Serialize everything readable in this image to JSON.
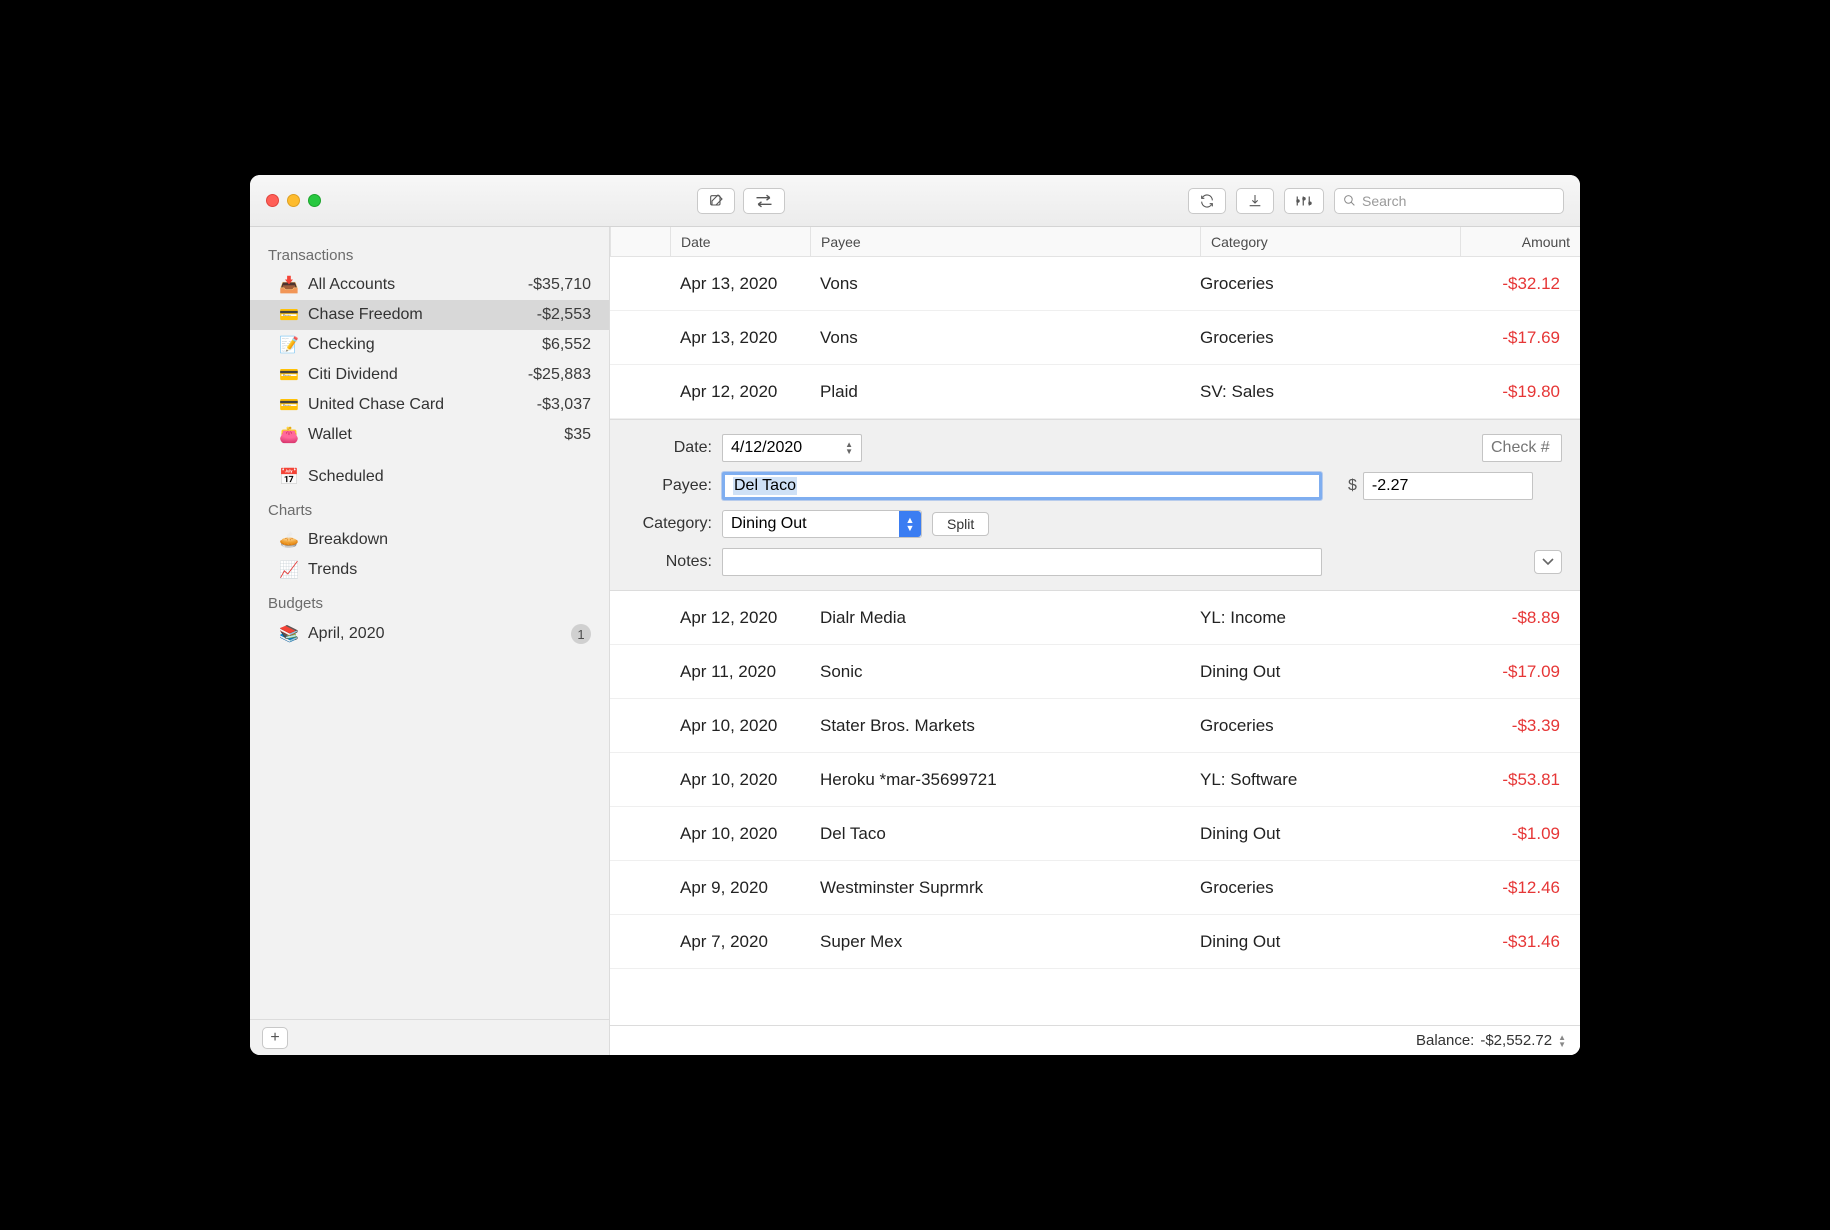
{
  "search": {
    "placeholder": "Search"
  },
  "sidebar": {
    "sections": [
      {
        "header": "Transactions",
        "items": [
          {
            "icon": "📥",
            "label": "All Accounts",
            "amount": "-$35,710",
            "selected": false
          },
          {
            "icon": "💳",
            "label": "Chase Freedom",
            "amount": "-$2,553",
            "selected": true
          },
          {
            "icon": "📝",
            "label": "Checking",
            "amount": "$6,552",
            "selected": false
          },
          {
            "icon": "💳",
            "label": "Citi Dividend",
            "amount": "-$25,883",
            "selected": false
          },
          {
            "icon": "💳",
            "label": "United Chase Card",
            "amount": "-$3,037",
            "selected": false
          },
          {
            "icon": "👛",
            "label": "Wallet",
            "amount": "$35",
            "selected": false
          },
          {
            "icon": "📅",
            "label": "Scheduled",
            "amount": "",
            "selected": false
          }
        ]
      },
      {
        "header": "Charts",
        "items": [
          {
            "icon": "🥧",
            "label": "Breakdown",
            "amount": "",
            "selected": false
          },
          {
            "icon": "📈",
            "label": "Trends",
            "amount": "",
            "selected": false
          }
        ]
      },
      {
        "header": "Budgets",
        "items": [
          {
            "icon": "📚",
            "label": "April, 2020",
            "amount": "",
            "badge": "1",
            "selected": false
          }
        ]
      }
    ]
  },
  "table": {
    "headers": {
      "date": "Date",
      "payee": "Payee",
      "category": "Category",
      "amount": "Amount"
    },
    "rows_before": [
      {
        "date": "Apr 13, 2020",
        "payee": "Vons",
        "category": "Groceries",
        "amount": "-$32.12"
      },
      {
        "date": "Apr 13, 2020",
        "payee": "Vons",
        "category": "Groceries",
        "amount": "-$17.69"
      },
      {
        "date": "Apr 12, 2020",
        "payee": "Plaid",
        "category": "SV: Sales",
        "amount": "-$19.80"
      }
    ],
    "rows_after": [
      {
        "date": "Apr 12, 2020",
        "payee": "Dialr Media",
        "category": "YL: Income",
        "amount": "-$8.89"
      },
      {
        "date": "Apr 11, 2020",
        "payee": "Sonic",
        "category": "Dining Out",
        "amount": "-$17.09"
      },
      {
        "date": "Apr 10, 2020",
        "payee": "Stater Bros. Markets",
        "category": "Groceries",
        "amount": "-$3.39"
      },
      {
        "date": "Apr 10, 2020",
        "payee": "Heroku *mar-35699721",
        "category": "YL: Software",
        "amount": "-$53.81"
      },
      {
        "date": "Apr 10, 2020",
        "payee": "Del Taco",
        "category": "Dining Out",
        "amount": "-$1.09"
      },
      {
        "date": "Apr 9, 2020",
        "payee": "Westminster Suprmrk",
        "category": "Groceries",
        "amount": "-$12.46"
      },
      {
        "date": "Apr 7, 2020",
        "payee": "Super Mex",
        "category": "Dining Out",
        "amount": "-$31.46"
      }
    ]
  },
  "editor": {
    "labels": {
      "date": "Date:",
      "payee": "Payee:",
      "category": "Category:",
      "notes": "Notes:"
    },
    "date": "4/12/2020",
    "check_placeholder": "Check #",
    "payee": "Del Taco",
    "currency": "$",
    "amount": "-2.27",
    "category": "Dining Out",
    "split_label": "Split",
    "notes": ""
  },
  "status": {
    "balance_label": "Balance:",
    "balance_value": "-$2,552.72"
  }
}
